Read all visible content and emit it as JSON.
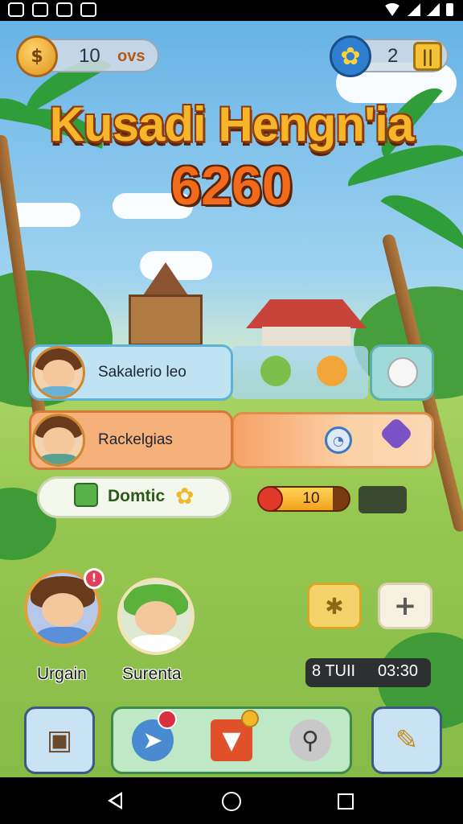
{
  "hud": {
    "coins": {
      "value": "10",
      "unit": "ovs"
    },
    "gems": {
      "value": "2",
      "button_label": "||"
    }
  },
  "title": "Kusadi Hengn'ia",
  "score": "6260",
  "rows": {
    "player_row": {
      "label": "Sakalerio leo"
    },
    "friend_row": {
      "label": "Rackelgias"
    },
    "bonus_row": {
      "label": "Domtic"
    }
  },
  "progress": {
    "value": "10",
    "fraction": 0.82
  },
  "players": [
    {
      "name": "Urgain"
    },
    {
      "name": "Surenta"
    }
  ],
  "notification_badge": "!",
  "timer": {
    "left": "8 TUII",
    "right": "03:30"
  },
  "colors": {
    "title": "#f7b52a",
    "score": "#f26a1c",
    "accent_green": "#3d8a4a",
    "accent_blue": "#3a5a80"
  },
  "icons": {
    "coin": "coin-icon",
    "gem": "flower-gem-icon",
    "camera": "camera-icon",
    "lightning": "lightning-icon",
    "bucket": "bucket-icon",
    "magnifier": "magnifier-icon",
    "pencil": "pencil-icon",
    "plus": "plus-icon",
    "star": "star-icon"
  }
}
